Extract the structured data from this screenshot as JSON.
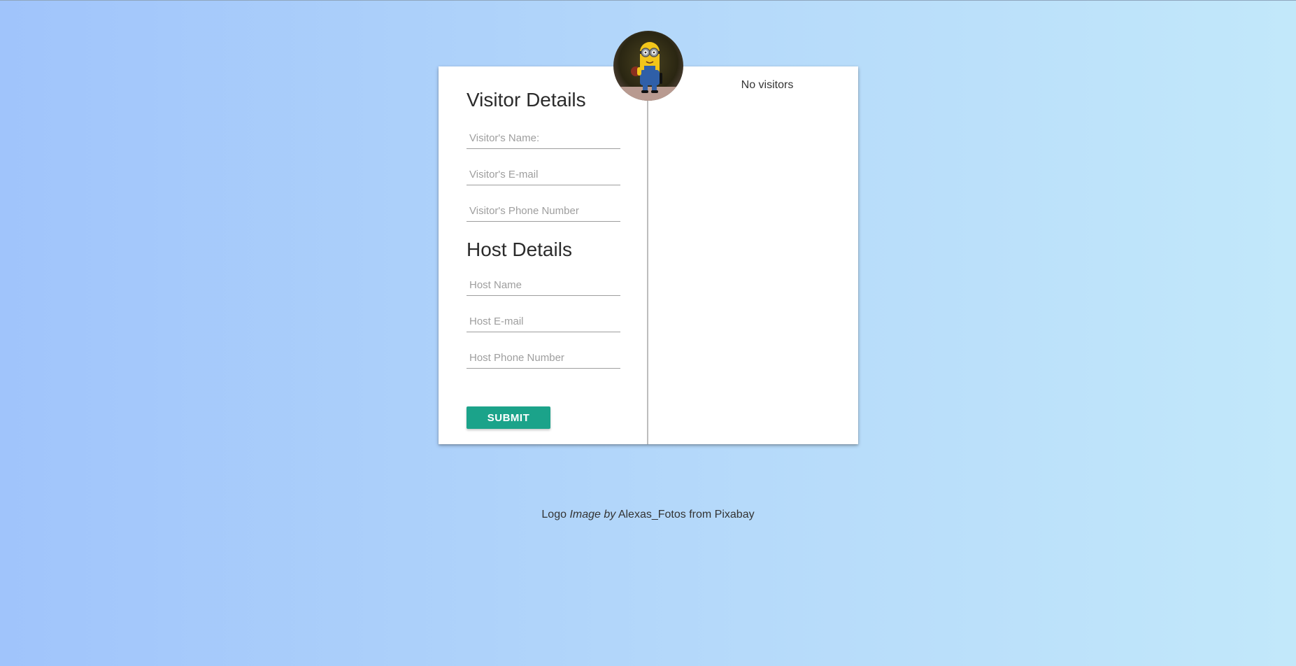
{
  "logo": {
    "icon": "minion-figure-avatar"
  },
  "visitor_section": {
    "title": "Visitor Details",
    "name_placeholder": "Visitor's Name:",
    "email_placeholder": "Visitor's E-mail",
    "phone_placeholder": "Visitor's Phone Number"
  },
  "host_section": {
    "title": "Host Details",
    "name_placeholder": "Host Name",
    "email_placeholder": "Host E-mail",
    "phone_placeholder": "Host Phone Number"
  },
  "submit_label": "SUBMIT",
  "visitors_panel": {
    "empty_text": "No visitors"
  },
  "credit": {
    "prefix": "Logo",
    "italic": "Image by",
    "author": "Alexas_Fotos",
    "middle": "from",
    "source": "Pixabay"
  },
  "colors": {
    "accent": "#1ba38a",
    "background_start": "#a0c4fb",
    "background_end": "#c2e8fa"
  }
}
